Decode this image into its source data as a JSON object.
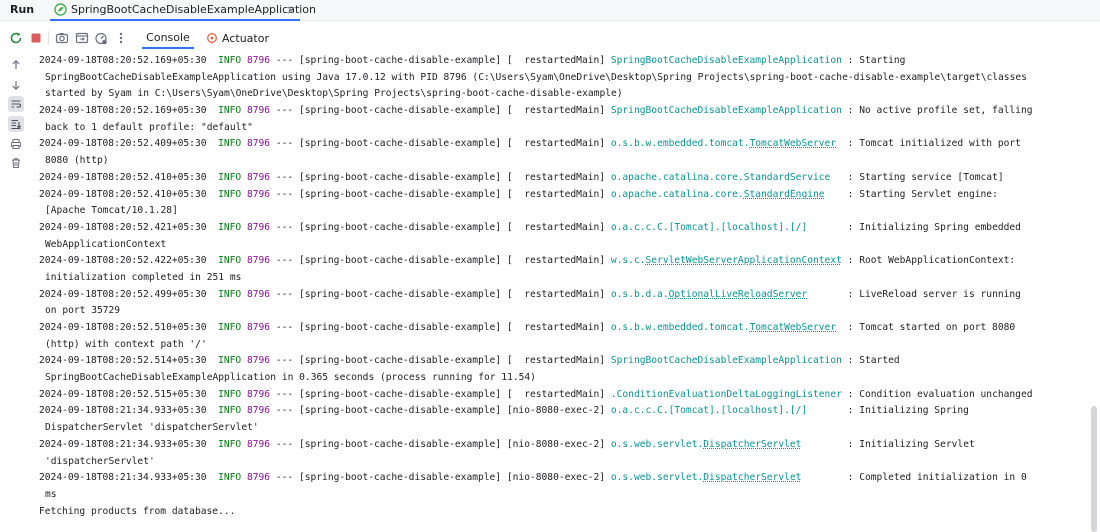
{
  "top": {
    "run_label": "Run",
    "tab_label": "SpringBootCacheDisableExampleApplication",
    "close_glyph": "×"
  },
  "toolbar": {
    "console_label": "Console",
    "actuator_label": "Actuator"
  },
  "console": {
    "lines": [
      {
        "ts": "2024-09-18T08:20:52.169+05:30",
        "lvl": "INFO",
        "pid": "8796",
        "mid": " --- [spring-boot-cache-disable-example] [  restartedMain] ",
        "logger": "SpringBootCacheDisableExampleApplication",
        "loggerMain": true,
        "under": "",
        "msg": " : Starting"
      },
      {
        "cont": "SpringBootCacheDisableExampleApplication using Java 17.0.12 with PID 8796 (C:\\Users\\Syam\\OneDrive\\Desktop\\Spring Projects\\spring-boot-cache-disable-example\\target\\classes"
      },
      {
        "cont": "started by Syam in C:\\Users\\Syam\\OneDrive\\Desktop\\Spring Projects\\spring-boot-cache-disable-example)"
      },
      {
        "ts": "2024-09-18T08:20:52.169+05:30",
        "lvl": "INFO",
        "pid": "8796",
        "mid": " --- [spring-boot-cache-disable-example] [  restartedMain] ",
        "logger": "SpringBootCacheDisableExampleApplication",
        "loggerMain": true,
        "under": "",
        "msg": " : No active profile set, falling"
      },
      {
        "cont": "back to 1 default profile: \"default\""
      },
      {
        "ts": "2024-09-18T08:20:52.409+05:30",
        "lvl": "INFO",
        "pid": "8796",
        "mid": " --- [spring-boot-cache-disable-example] [  restartedMain] ",
        "logger": "o.s.b.w.embedded.tomcat.",
        "under": "TomcatWebServer",
        "msg": "  : Tomcat initialized with port"
      },
      {
        "cont": "8080 (http)"
      },
      {
        "ts": "2024-09-18T08:20:52.410+05:30",
        "lvl": "INFO",
        "pid": "8796",
        "mid": " --- [spring-boot-cache-disable-example] [  restartedMain] ",
        "logger": "o.apache.catalina.core.StandardService",
        "under": "",
        "msg": "   : Starting service [Tomcat]"
      },
      {
        "ts": "2024-09-18T08:20:52.410+05:30",
        "lvl": "INFO",
        "pid": "8796",
        "mid": " --- [spring-boot-cache-disable-example] [  restartedMain] ",
        "logger": "o.apache.catalina.core.",
        "under": "StandardEngine",
        "msg": "    : Starting Servlet engine:"
      },
      {
        "cont": "[Apache Tomcat/10.1.28]"
      },
      {
        "ts": "2024-09-18T08:20:52.421+05:30",
        "lvl": "INFO",
        "pid": "8796",
        "mid": " --- [spring-boot-cache-disable-example] [  restartedMain] ",
        "logger": "o.a.c.c.C.[Tomcat].[localhost].[/]",
        "under": "",
        "msg": "       : Initializing Spring embedded"
      },
      {
        "cont": "WebApplicationContext"
      },
      {
        "ts": "2024-09-18T08:20:52.422+05:30",
        "lvl": "INFO",
        "pid": "8796",
        "mid": " --- [spring-boot-cache-disable-example] [  restartedMain] ",
        "logger": "w.s.c.",
        "under": "ServletWebServerApplicationContext",
        "msg": " : Root WebApplicationContext:"
      },
      {
        "cont": "initialization completed in 251 ms"
      },
      {
        "ts": "2024-09-18T08:20:52.499+05:30",
        "lvl": "INFO",
        "pid": "8796",
        "mid": " --- [spring-boot-cache-disable-example] [  restartedMain] ",
        "logger": "o.s.b.d.a.",
        "under": "OptionalLiveReloadServer",
        "msg": "       : LiveReload server is running"
      },
      {
        "cont": "on port 35729"
      },
      {
        "ts": "2024-09-18T08:20:52.510+05:30",
        "lvl": "INFO",
        "pid": "8796",
        "mid": " --- [spring-boot-cache-disable-example] [  restartedMain] ",
        "logger": "o.s.b.w.embedded.tomcat.",
        "under": "TomcatWebServer",
        "msg": "  : Tomcat started on port 8080"
      },
      {
        "cont": "(http) with context path '/'"
      },
      {
        "ts": "2024-09-18T08:20:52.514+05:30",
        "lvl": "INFO",
        "pid": "8796",
        "mid": " --- [spring-boot-cache-disable-example] [  restartedMain] ",
        "logger": "SpringBootCacheDisableExampleApplication",
        "loggerMain": true,
        "under": "",
        "msg": " : Started"
      },
      {
        "cont": "SpringBootCacheDisableExampleApplication in 0.365 seconds (process running for 11.54)"
      },
      {
        "ts": "2024-09-18T08:20:52.515+05:30",
        "lvl": "INFO",
        "pid": "8796",
        "mid": " --- [spring-boot-cache-disable-example] [  restartedMain] ",
        "logger": ".ConditionEvaluationDeltaLoggingListener",
        "under": "",
        "msg": " : Condition evaluation unchanged"
      },
      {
        "ts": "2024-09-18T08:21:34.933+05:30",
        "lvl": "INFO",
        "pid": "8796",
        "mid": " --- [spring-boot-cache-disable-example] [nio-8080-exec-2] ",
        "logger": "o.a.c.c.C.[Tomcat].[localhost].[/]",
        "under": "",
        "msg": "       : Initializing Spring"
      },
      {
        "cont": "DispatcherServlet 'dispatcherServlet'"
      },
      {
        "ts": "2024-09-18T08:21:34.933+05:30",
        "lvl": "INFO",
        "pid": "8796",
        "mid": " --- [spring-boot-cache-disable-example] [nio-8080-exec-2] ",
        "logger": "o.s.web.servlet.",
        "under": "DispatcherServlet",
        "msg": "        : Initializing Servlet"
      },
      {
        "cont": "'dispatcherServlet'"
      },
      {
        "ts": "2024-09-18T08:21:34.933+05:30",
        "lvl": "INFO",
        "pid": "8796",
        "mid": " --- [spring-boot-cache-disable-example] [nio-8080-exec-2] ",
        "logger": "o.s.web.servlet.",
        "under": "DispatcherServlet",
        "msg": "        : Completed initialization in 0"
      },
      {
        "cont": "ms"
      },
      {
        "plain": "Fetching products from database..."
      }
    ]
  }
}
